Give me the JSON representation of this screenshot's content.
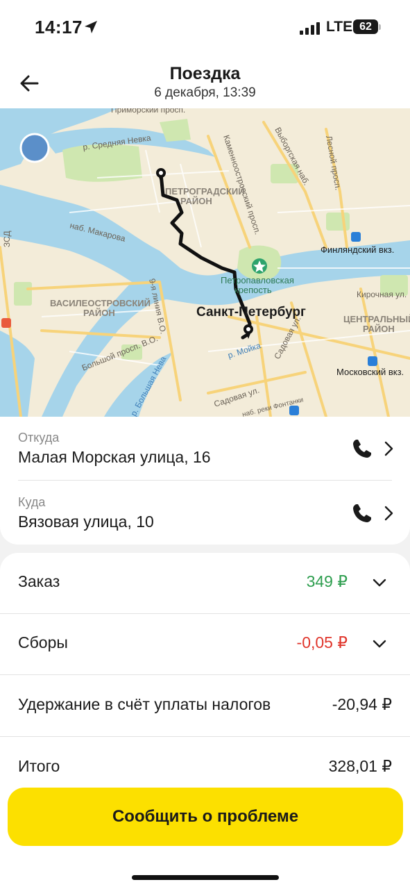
{
  "status_bar": {
    "time": "14:17",
    "network": "LTE",
    "battery": "62"
  },
  "header": {
    "title": "Поездка",
    "subtitle": "6 декабря, 13:39",
    "back_icon": "arrow-left-icon"
  },
  "map": {
    "labels": {
      "primorsky": "Приморский просп.",
      "sr_neva": "р. Средняя Невка",
      "vyborgskaya": "Выборгская наб.",
      "lesnoy": "Лесной просп.",
      "kamennoostr": "Каменноостровский просп.",
      "petrogradsky": "ПЕТРОГРАДСКИЙ\nРАЙОН",
      "makarova": "наб. Макарова",
      "finlyandsky": "Финляндский вкз.",
      "petropavl": "Петропавловская\nкрепость",
      "vasileostr": "ВАСИЛЕОСТРОВСКИЙ\nРАЙОН",
      "liniya": "9-я линия В.О.",
      "spb": "Санкт-Петербург",
      "kirochnaya": "Кирочная ул.",
      "centralny": "ЦЕНТРАЛЬНЫЙ\nРАЙОН",
      "moika": "р. Мойка",
      "bolshoy": "Большой просп. В.О.",
      "sadovaya": "Садовая ул.",
      "moskovsky": "Московский вкз.",
      "fontanka": "наб. реки Фонтанки",
      "b_neva": "р. Большая Нева",
      "zsd": "ЗСД"
    },
    "accent_route": "#111111",
    "water_color": "#a6d4ea",
    "park_color": "#cfe7b0"
  },
  "addresses": {
    "from": {
      "label": "Откуда",
      "value": "Малая Морская улица, 16"
    },
    "to": {
      "label": "Куда",
      "value": "Вязовая улица, 10"
    }
  },
  "summary": {
    "order": {
      "label": "Заказ",
      "value": "349 ₽",
      "color": "#2e9e4f"
    },
    "fees": {
      "label": "Сборы",
      "value": "-0,05 ₽",
      "color": "#e0352b"
    },
    "tax": {
      "label": "Удержание в счёт уплаты налогов",
      "value": "-20,94 ₽"
    },
    "total": {
      "label": "Итого",
      "value": "328,01 ₽"
    }
  },
  "actions": {
    "report": "Сообщить о проблеме",
    "report_color": "#fce000"
  }
}
